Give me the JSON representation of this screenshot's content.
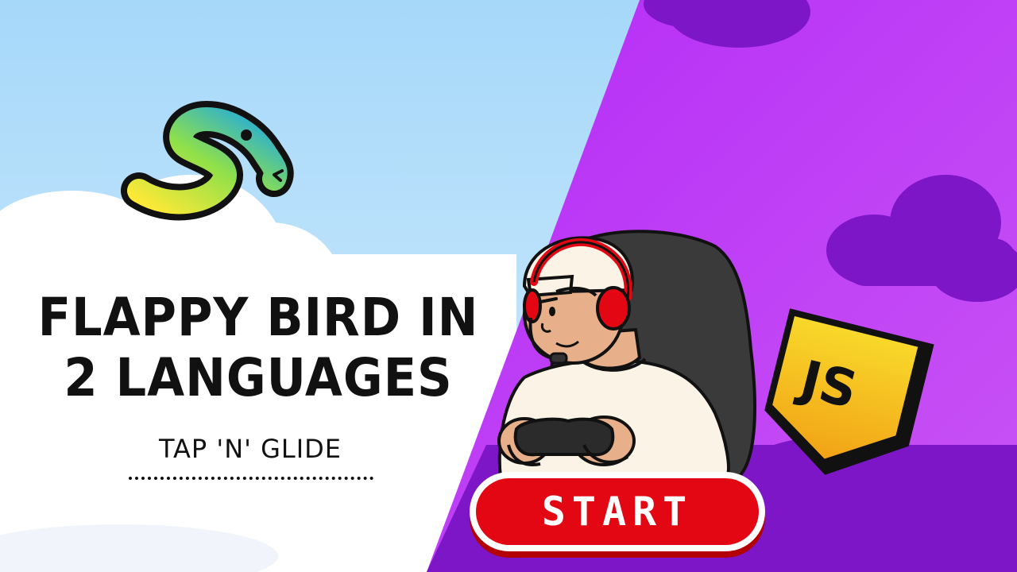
{
  "title": "FLAPPY BIRD IN 2 LANGUAGES",
  "subtitle": "TAP 'N' GLIDE",
  "start_button": {
    "label": "START"
  },
  "js_badge": {
    "label": "JS"
  },
  "colors": {
    "sky": "#bfe3fb",
    "purple": "#b833f5",
    "dark_purple": "#7a12c8",
    "start_red": "#e30613",
    "js_yellow": "#f4c21d"
  },
  "icons": [
    "python-snake-icon",
    "javascript-badge-icon",
    "gamer-character",
    "gaming-chair"
  ]
}
